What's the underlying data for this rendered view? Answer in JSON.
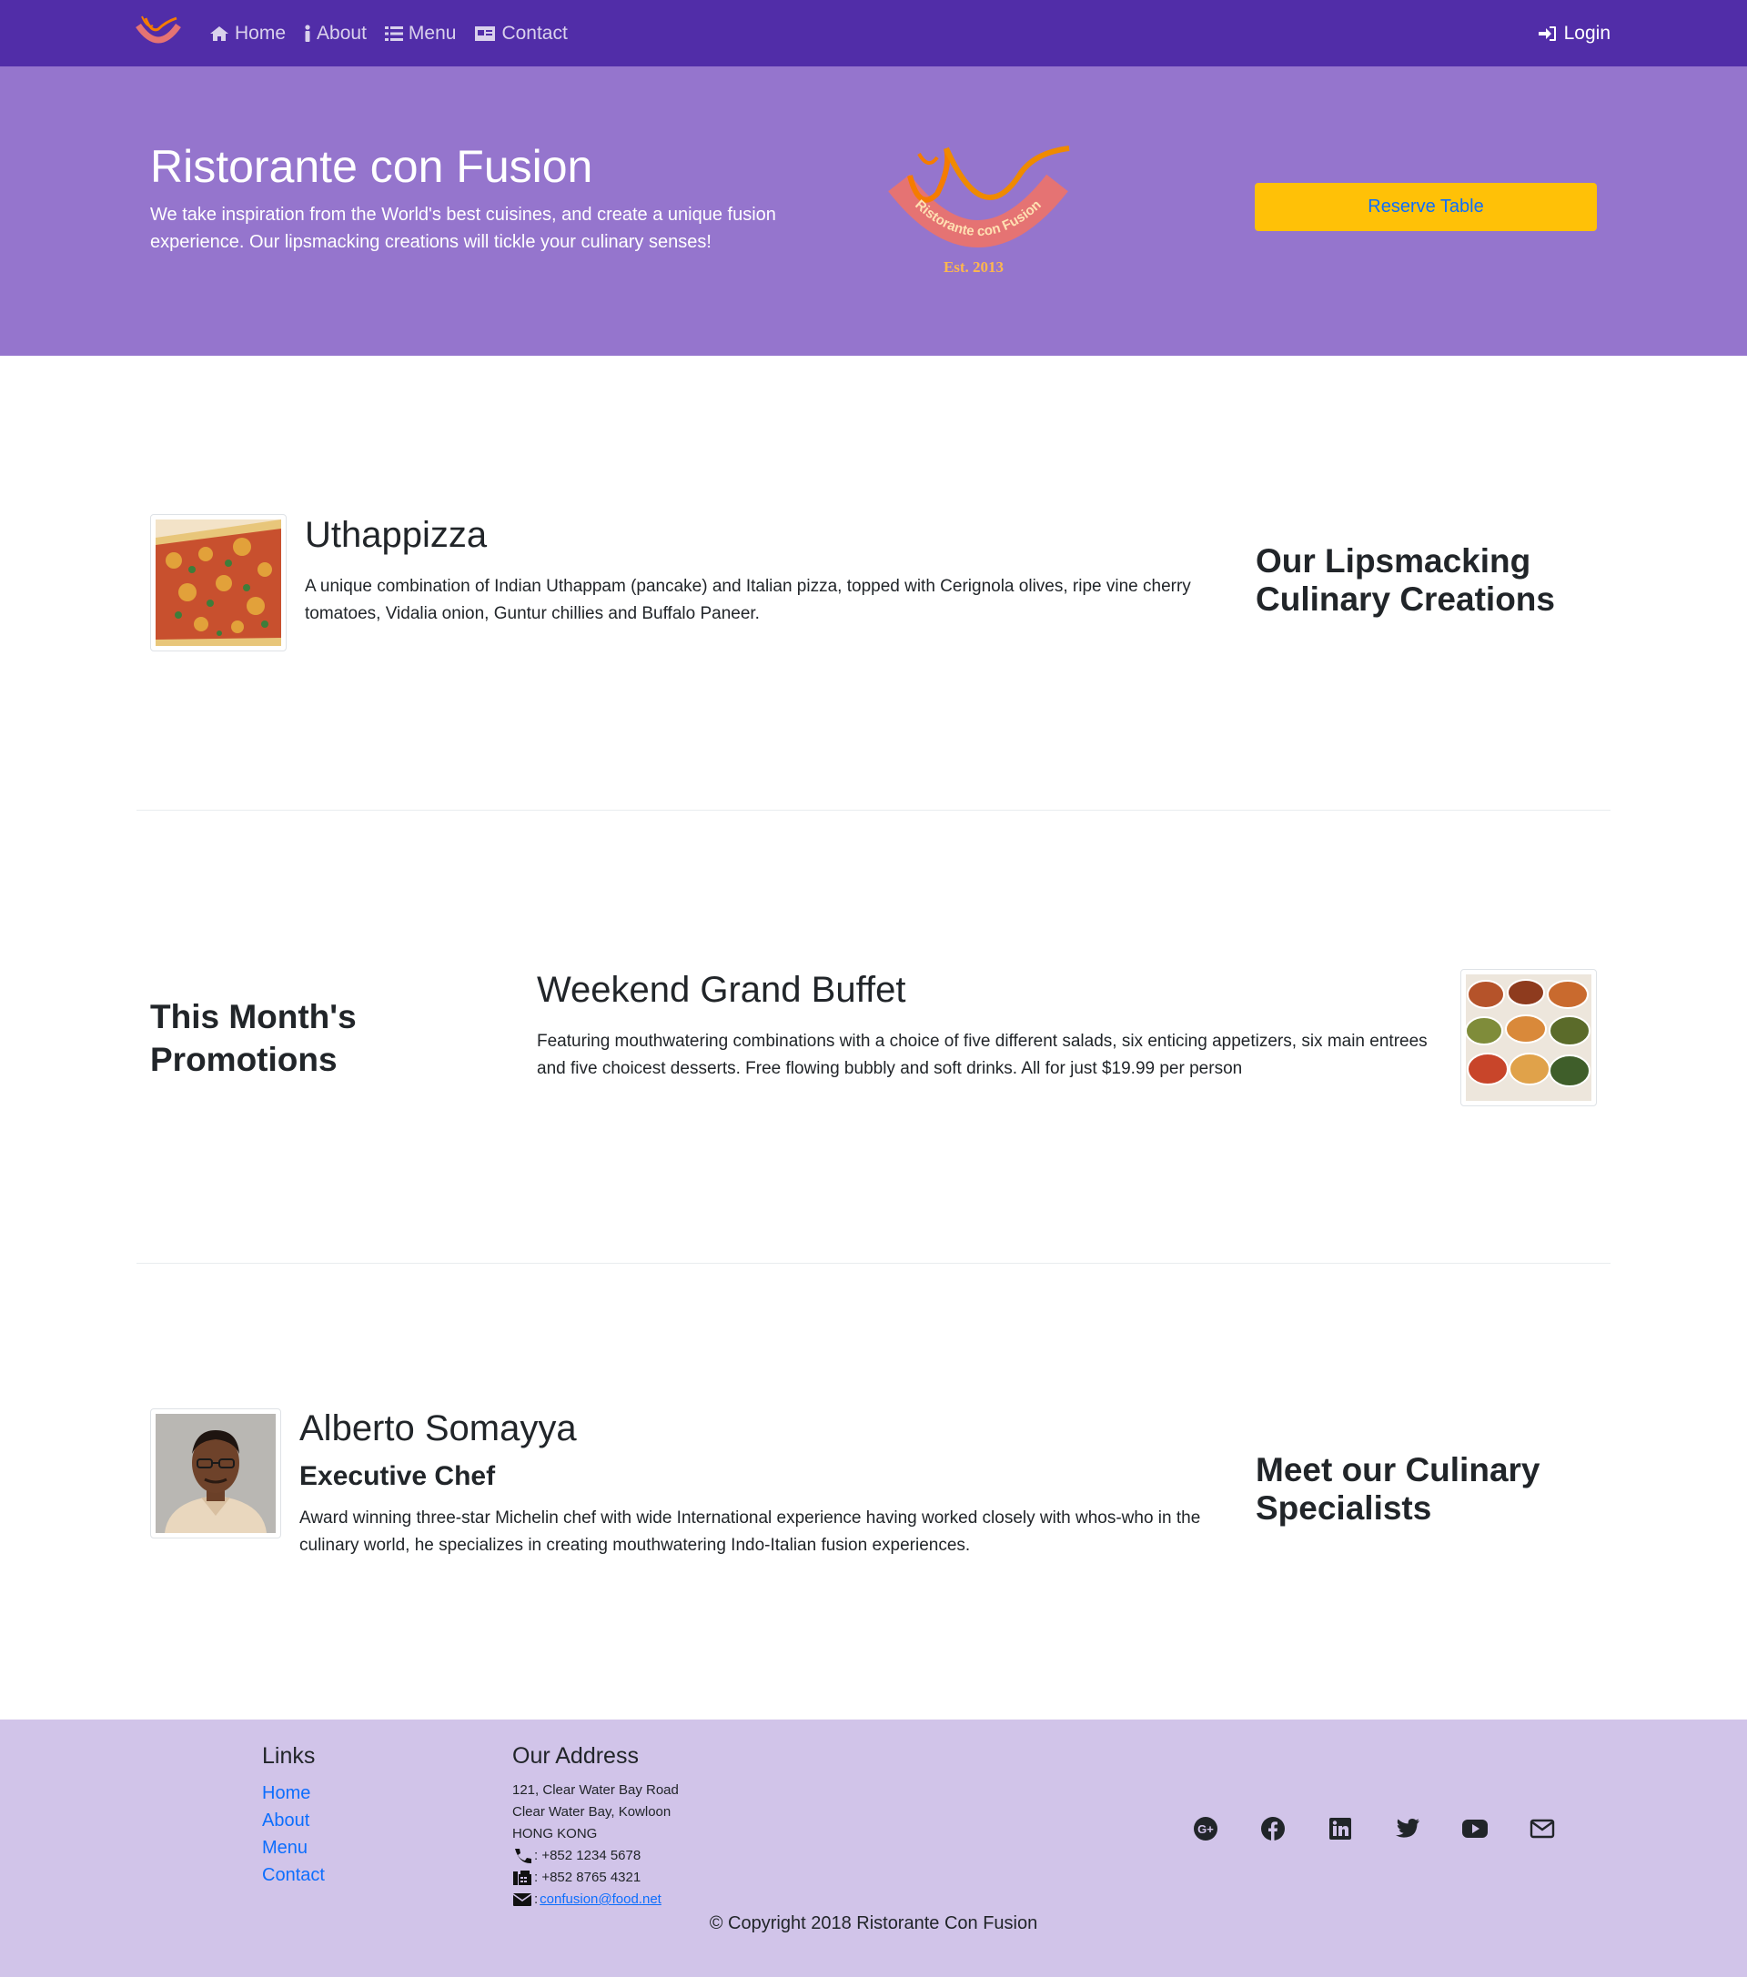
{
  "nav": {
    "items": [
      {
        "label": "Home",
        "icon": "home-icon"
      },
      {
        "label": "About",
        "icon": "info-icon"
      },
      {
        "label": "Menu",
        "icon": "list-icon"
      },
      {
        "label": "Contact",
        "icon": "address-card-icon"
      }
    ],
    "login_label": "Login"
  },
  "hero": {
    "title": "Ristorante con Fusion",
    "text": "We take inspiration from the World's best cuisines, and create a unique fusion experience. Our lipsmacking creations will tickle your culinary senses!",
    "logo_text": "Ristorante con Fusion",
    "logo_est": "Est. 2013",
    "reserve_label": "Reserve Table"
  },
  "dish": {
    "name": "Uthappizza",
    "description": "A unique combination of Indian Uthappam (pancake) and Italian pizza, topped with Cerignola olives, ripe vine cherry tomatoes, Vidalia onion, Guntur chillies and Buffalo Paneer.",
    "side_heading": "Our Lipsmacking Culinary Creations"
  },
  "promotion": {
    "side_heading": "This Month's Promotions",
    "name": "Weekend Grand Buffet",
    "description": "Featuring mouthwatering combinations with a choice of five different salads, six enticing appetizers, six main entrees and five choicest desserts. Free flowing bubbly and soft drinks. All for just $19.99 per person"
  },
  "leader": {
    "name": "Alberto Somayya",
    "designation": "Executive Chef",
    "description": "Award winning three-star Michelin chef with wide International experience having worked closely with whos-who in the culinary world, he specializes in creating mouthwatering Indo-Italian fusion experiences.",
    "side_heading": "Meet our Culinary Specialists"
  },
  "footer": {
    "links_heading": "Links",
    "links": [
      "Home",
      "About",
      "Menu",
      "Contact"
    ],
    "address_heading": "Our Address",
    "address_lines": [
      "121, Clear Water Bay Road",
      "Clear Water Bay, Kowloon",
      "HONG KONG"
    ],
    "phone": ": +852 1234 5678",
    "fax": ": +852 8765 4321",
    "email_prefix": ": ",
    "email": "confusion@food.net",
    "socials": [
      "google-plus-icon",
      "facebook-icon",
      "linkedin-icon",
      "twitter-icon",
      "youtube-icon",
      "envelope-icon"
    ],
    "copyright": "© Copyright 2018 Ristorante Con Fusion"
  },
  "colors": {
    "navbar": "#512DA8",
    "jumbotron": "#9575CD",
    "footer": "#D1C4E9",
    "reserve_button": "#FFC107",
    "link": "#0d6efd"
  }
}
